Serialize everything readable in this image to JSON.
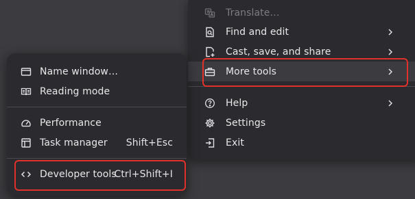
{
  "main_menu": {
    "items": [
      {
        "label": "Translate…",
        "icon": "translate-icon",
        "disabled": true,
        "has_submenu": false
      },
      {
        "label": "Find and edit",
        "icon": "find-edit-icon",
        "disabled": false,
        "has_submenu": true
      },
      {
        "label": "Cast, save, and share",
        "icon": "cast-save-share-icon",
        "disabled": false,
        "has_submenu": true
      },
      {
        "label": "More tools",
        "icon": "toolbox-icon",
        "disabled": false,
        "has_submenu": true,
        "highlighted": true
      },
      {
        "label": "Help",
        "icon": "help-icon",
        "disabled": false,
        "has_submenu": true
      },
      {
        "label": "Settings",
        "icon": "gear-icon",
        "disabled": false,
        "has_submenu": false
      },
      {
        "label": "Exit",
        "icon": "exit-icon",
        "disabled": false,
        "has_submenu": false
      }
    ]
  },
  "more_tools_submenu": {
    "items": [
      {
        "label": "Name window…",
        "icon": "window-icon",
        "shortcut": ""
      },
      {
        "label": "Reading mode",
        "icon": "book-icon",
        "shortcut": ""
      },
      {
        "label": "Performance",
        "icon": "speedometer-icon",
        "shortcut": ""
      },
      {
        "label": "Task manager",
        "icon": "task-manager-icon",
        "shortcut": "Shift+Esc"
      },
      {
        "label": "Developer tools",
        "icon": "code-icon",
        "shortcut": "Ctrl+Shift+I"
      }
    ]
  },
  "colors": {
    "background": "#3c3c40",
    "menu_background": "#2b2b2f",
    "highlight_row": "#3b3b40",
    "annotation_red": "#e0312a",
    "text": "#e8e8ea",
    "disabled_text": "#7c7c82"
  }
}
